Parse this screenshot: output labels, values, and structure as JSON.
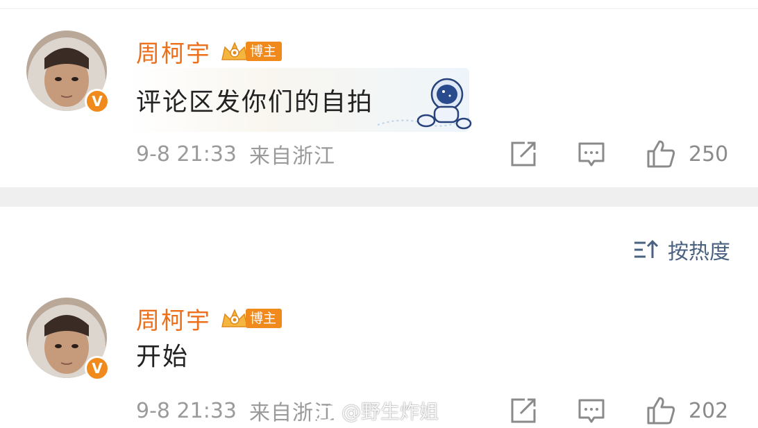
{
  "posts": [
    {
      "username": "周柯宇",
      "badge_label": "博主",
      "verified_mark": "V",
      "comment": "评论区发你们的自拍",
      "time": "9-8 21:33",
      "location": "来自浙江",
      "like_count": "250",
      "sticker_icon": "astronaut-sticker"
    },
    {
      "username": "周柯宇",
      "badge_label": "博主",
      "verified_mark": "V",
      "comment": "开始",
      "time": "9-8 21:33",
      "location": "来自浙江",
      "like_count": "202"
    }
  ],
  "sort": {
    "label": "按热度"
  },
  "watermark": {
    "text": "@野生炸姐"
  },
  "colors": {
    "username": "#ec6f1b",
    "badge": "#f08a1d",
    "meta_text": "#9a9a9a",
    "sort_text": "#4a6280",
    "divider": "#efefef"
  },
  "icons": {
    "share": "share-icon",
    "comment": "comment-icon",
    "like": "thumbs-up-icon",
    "sort": "sort-icon",
    "crown": "crown-icon"
  }
}
